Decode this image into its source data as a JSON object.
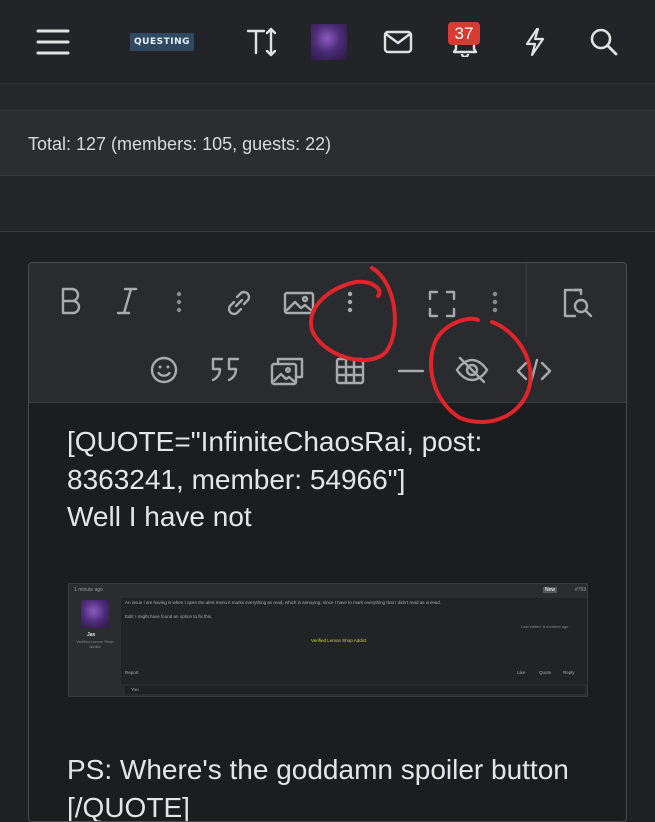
{
  "header": {
    "logo_text": "QUESTING",
    "notification_count": "37",
    "icons": [
      "menu-icon",
      "text-size-icon",
      "avatar",
      "envelope-icon",
      "bell-icon",
      "lightning-icon",
      "search-icon"
    ]
  },
  "online": {
    "text": "Total: 127 (members: 105, guests: 22)"
  },
  "editor": {
    "toolbar_row1": [
      "bold-icon",
      "italic-icon",
      "more-vertical-icon",
      "link-icon",
      "image-icon",
      "more-vertical-icon",
      "fullscreen-icon",
      "more-vertical-icon",
      "preview-icon"
    ],
    "toolbar_row2": [
      "smiley-icon",
      "quote-icon",
      "media-icon",
      "table-icon",
      "horizontal-line-icon",
      "spoiler-eye-off-icon",
      "code-icon"
    ],
    "lines": [
      "[QUOTE=\"InfiniteChaosRai, post:",
      "8363241, member: 54966\"]",
      "Well I have not"
    ],
    "ps_line": "PS: Where's the goddamn spoiler button",
    "ps_line2": "[/QUOTE]"
  },
  "embedded_screenshot": {
    "time": "1 minute ago",
    "username": "Jax",
    "role": "Verified Lemon Shop Addict",
    "message": "An issue I am having is when I open the alert menu it marks everything as read, which is annoying, since I have to mark everything that I didn't read as unread.",
    "edit_note": "Edit: I might have found an option to fix this.",
    "edited": "Last edited: A moment ago",
    "signature": "Verified Lemon Shop Addict",
    "report": "Report",
    "actions": [
      "Like",
      "Quote",
      "Reply"
    ],
    "post_number": "#793",
    "new_label": "New",
    "likes": "You"
  },
  "colors": {
    "background": "#1f2023",
    "toolbar": "#2a2b2f",
    "badge": "#d83b32",
    "annotation": "#e0242a",
    "text": "#e4e5e7"
  }
}
